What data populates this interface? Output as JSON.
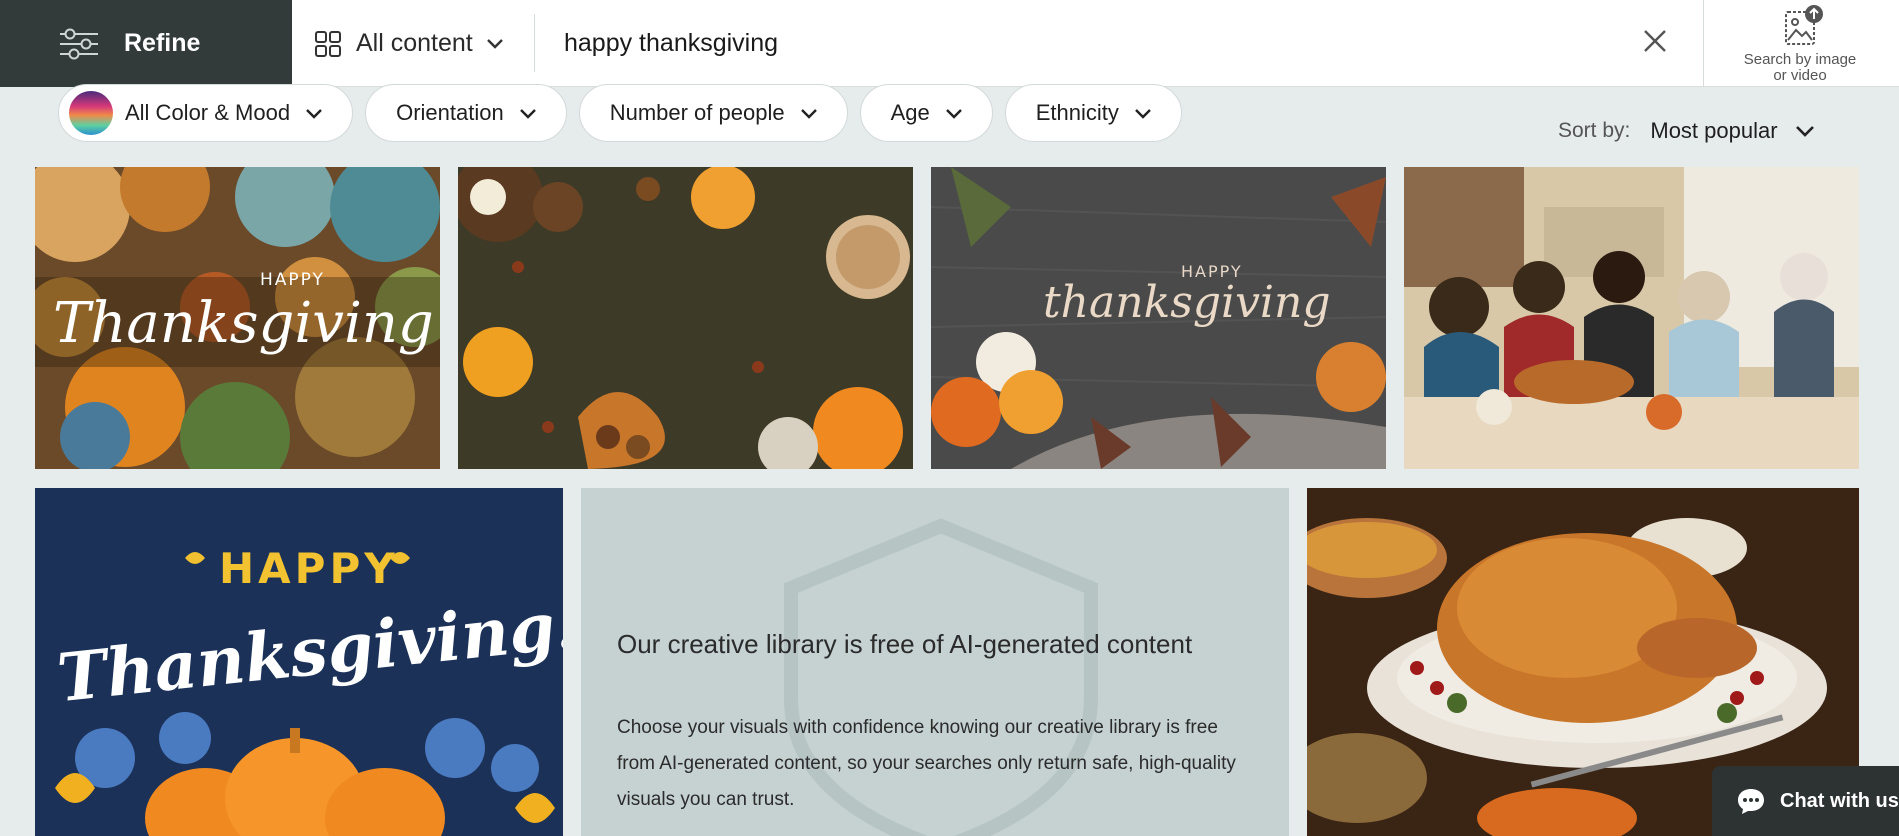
{
  "topbar": {
    "refine_label": "Refine",
    "content_type": "All content",
    "search_value": "happy thanksgiving",
    "search_by_image_line1": "Search by image",
    "search_by_image_line2": "or video"
  },
  "filters": [
    {
      "label": "All Color & Mood"
    },
    {
      "label": "Orientation"
    },
    {
      "label": "Number of people"
    },
    {
      "label": "Age"
    },
    {
      "label": "Ethnicity"
    }
  ],
  "sort": {
    "label": "Sort by:",
    "value": "Most popular"
  },
  "images": {
    "t1_small": "HAPPY",
    "t1_script": "Thanksgiving",
    "t3_small": "HAPPY",
    "t3_script": "thanksgiving",
    "t5_top": "HAPPY",
    "t5_script": "Thanksgiving!"
  },
  "ai_card": {
    "title": "Our creative library is free of AI-generated content",
    "body": "Choose your visuals with confidence knowing our creative library is free from AI-generated content, so your searches only return safe, high-quality visuals you can trust."
  },
  "chat": {
    "label": "Chat with us"
  },
  "colors": {
    "refine_bg": "#333b3a",
    "page_bg": "#e6ecec",
    "ai_card_bg": "#c5d2d1",
    "chat_bg": "#2c3332"
  }
}
